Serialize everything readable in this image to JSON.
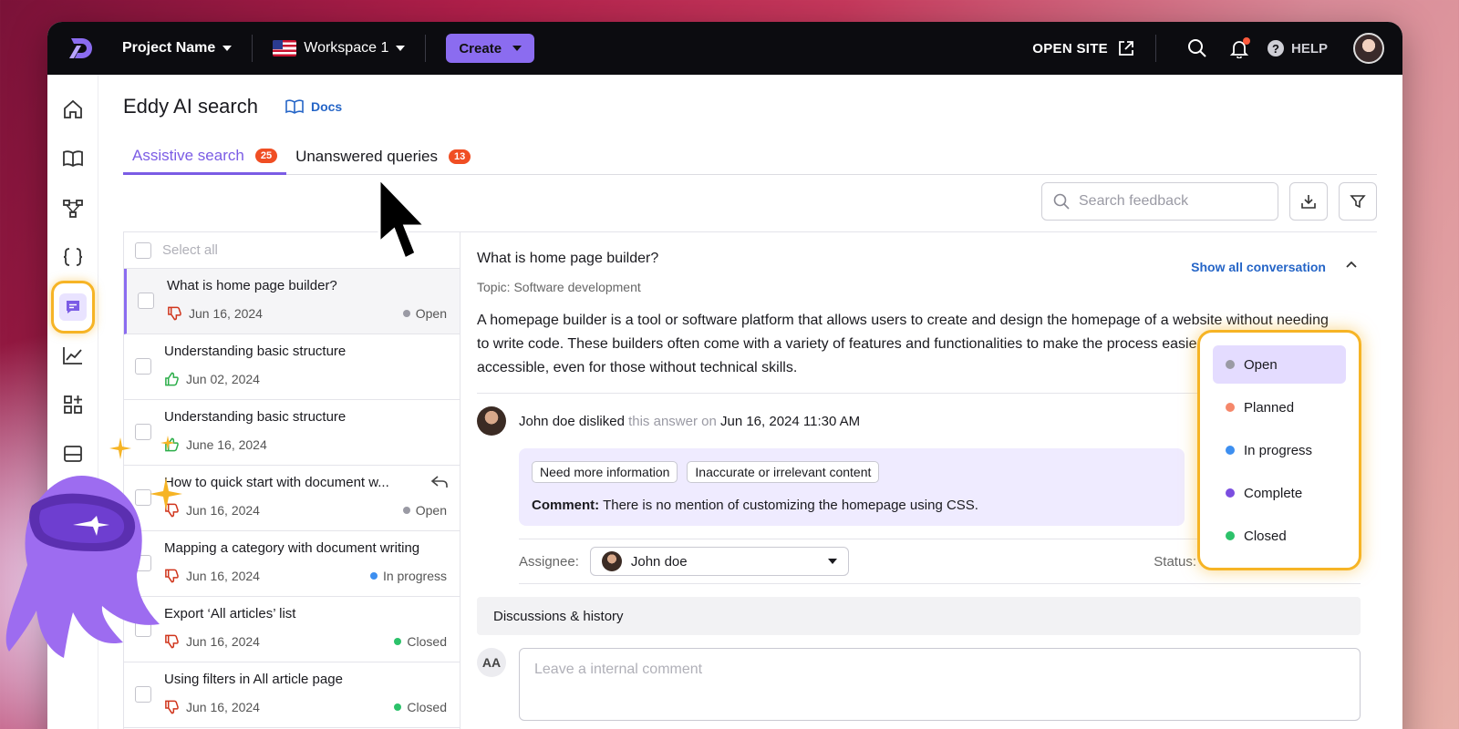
{
  "topbar": {
    "project_name": "Project Name",
    "workspace": "Workspace 1",
    "create_label": "Create",
    "open_site_label": "OPEN SITE",
    "help_label": "HELP"
  },
  "page": {
    "title": "Eddy AI search",
    "docs_label": "Docs"
  },
  "tabs": [
    {
      "label": "Assistive search",
      "count": "25"
    },
    {
      "label": "Unanswered queries",
      "count": "13"
    }
  ],
  "search": {
    "placeholder": "Search feedback"
  },
  "list": {
    "select_all": "Select all",
    "items": [
      {
        "title": "What is home page builder?",
        "date": "Jun 16, 2024",
        "reaction": "dislike",
        "status": "Open",
        "status_color": "#9a9aa4"
      },
      {
        "title": "Understanding basic structure",
        "date": "Jun 02, 2024",
        "reaction": "like",
        "status": "",
        "status_color": ""
      },
      {
        "title": "Understanding basic structure",
        "date": "June 16, 2024",
        "reaction": "like",
        "status": "",
        "status_color": ""
      },
      {
        "title": "How to quick start with document w...",
        "date": "Jun 16, 2024",
        "reaction": "dislike",
        "status": "Open",
        "status_color": "#9a9aa4"
      },
      {
        "title": "Mapping a category with document writing",
        "date": "Jun 16, 2024",
        "reaction": "dislike",
        "status": "In progress",
        "status_color": "#3d8ff0"
      },
      {
        "title": "Export ‘All articles’ list",
        "date": "Jun 16, 2024",
        "reaction": "dislike",
        "status": "Closed",
        "status_color": "#2cc26a"
      },
      {
        "title": "Using filters in All article page",
        "date": "Jun 16, 2024",
        "reaction": "dislike",
        "status": "Closed",
        "status_color": "#2cc26a"
      }
    ]
  },
  "detail": {
    "question": "What is home page builder?",
    "topic": "Topic: Software development",
    "show_all_label": "Show all conversation",
    "answer": "A homepage builder is a tool or software platform that allows users to create and design the homepage of a website without needing to write code. These builders often come with a variety of features and functionalities to make the process easier and more accessible, even for those without technical skills.",
    "feedback_user": "John doe disliked",
    "feedback_mid": "this answer on",
    "feedback_date": "Jun 16, 2024 11:30 AM",
    "chips": [
      "Need more information",
      "Inaccurate or irrelevant content"
    ],
    "comment_label": "Comment:",
    "comment_text": "There is no mention of customizing the homepage using CSS.",
    "assignee_label": "Assignee:",
    "assignee_value": "John doe",
    "status_label": "Status:",
    "discussions_label": "Discussions & history",
    "commenter_initials": "AA",
    "comment_placeholder": "Leave a internal comment"
  },
  "status_dropdown": {
    "options": [
      {
        "label": "Open",
        "color": "#9a9aa4"
      },
      {
        "label": "Planned",
        "color": "#f5876a"
      },
      {
        "label": "In progress",
        "color": "#3d8ff0"
      },
      {
        "label": "Complete",
        "color": "#7b4ee0"
      },
      {
        "label": "Closed",
        "color": "#2cc26a"
      }
    ],
    "selected": "Open"
  },
  "colors": {
    "accent": "#8b6cf0",
    "highlight": "#f6b425",
    "badge": "#f04e23",
    "link": "#2565c7"
  }
}
